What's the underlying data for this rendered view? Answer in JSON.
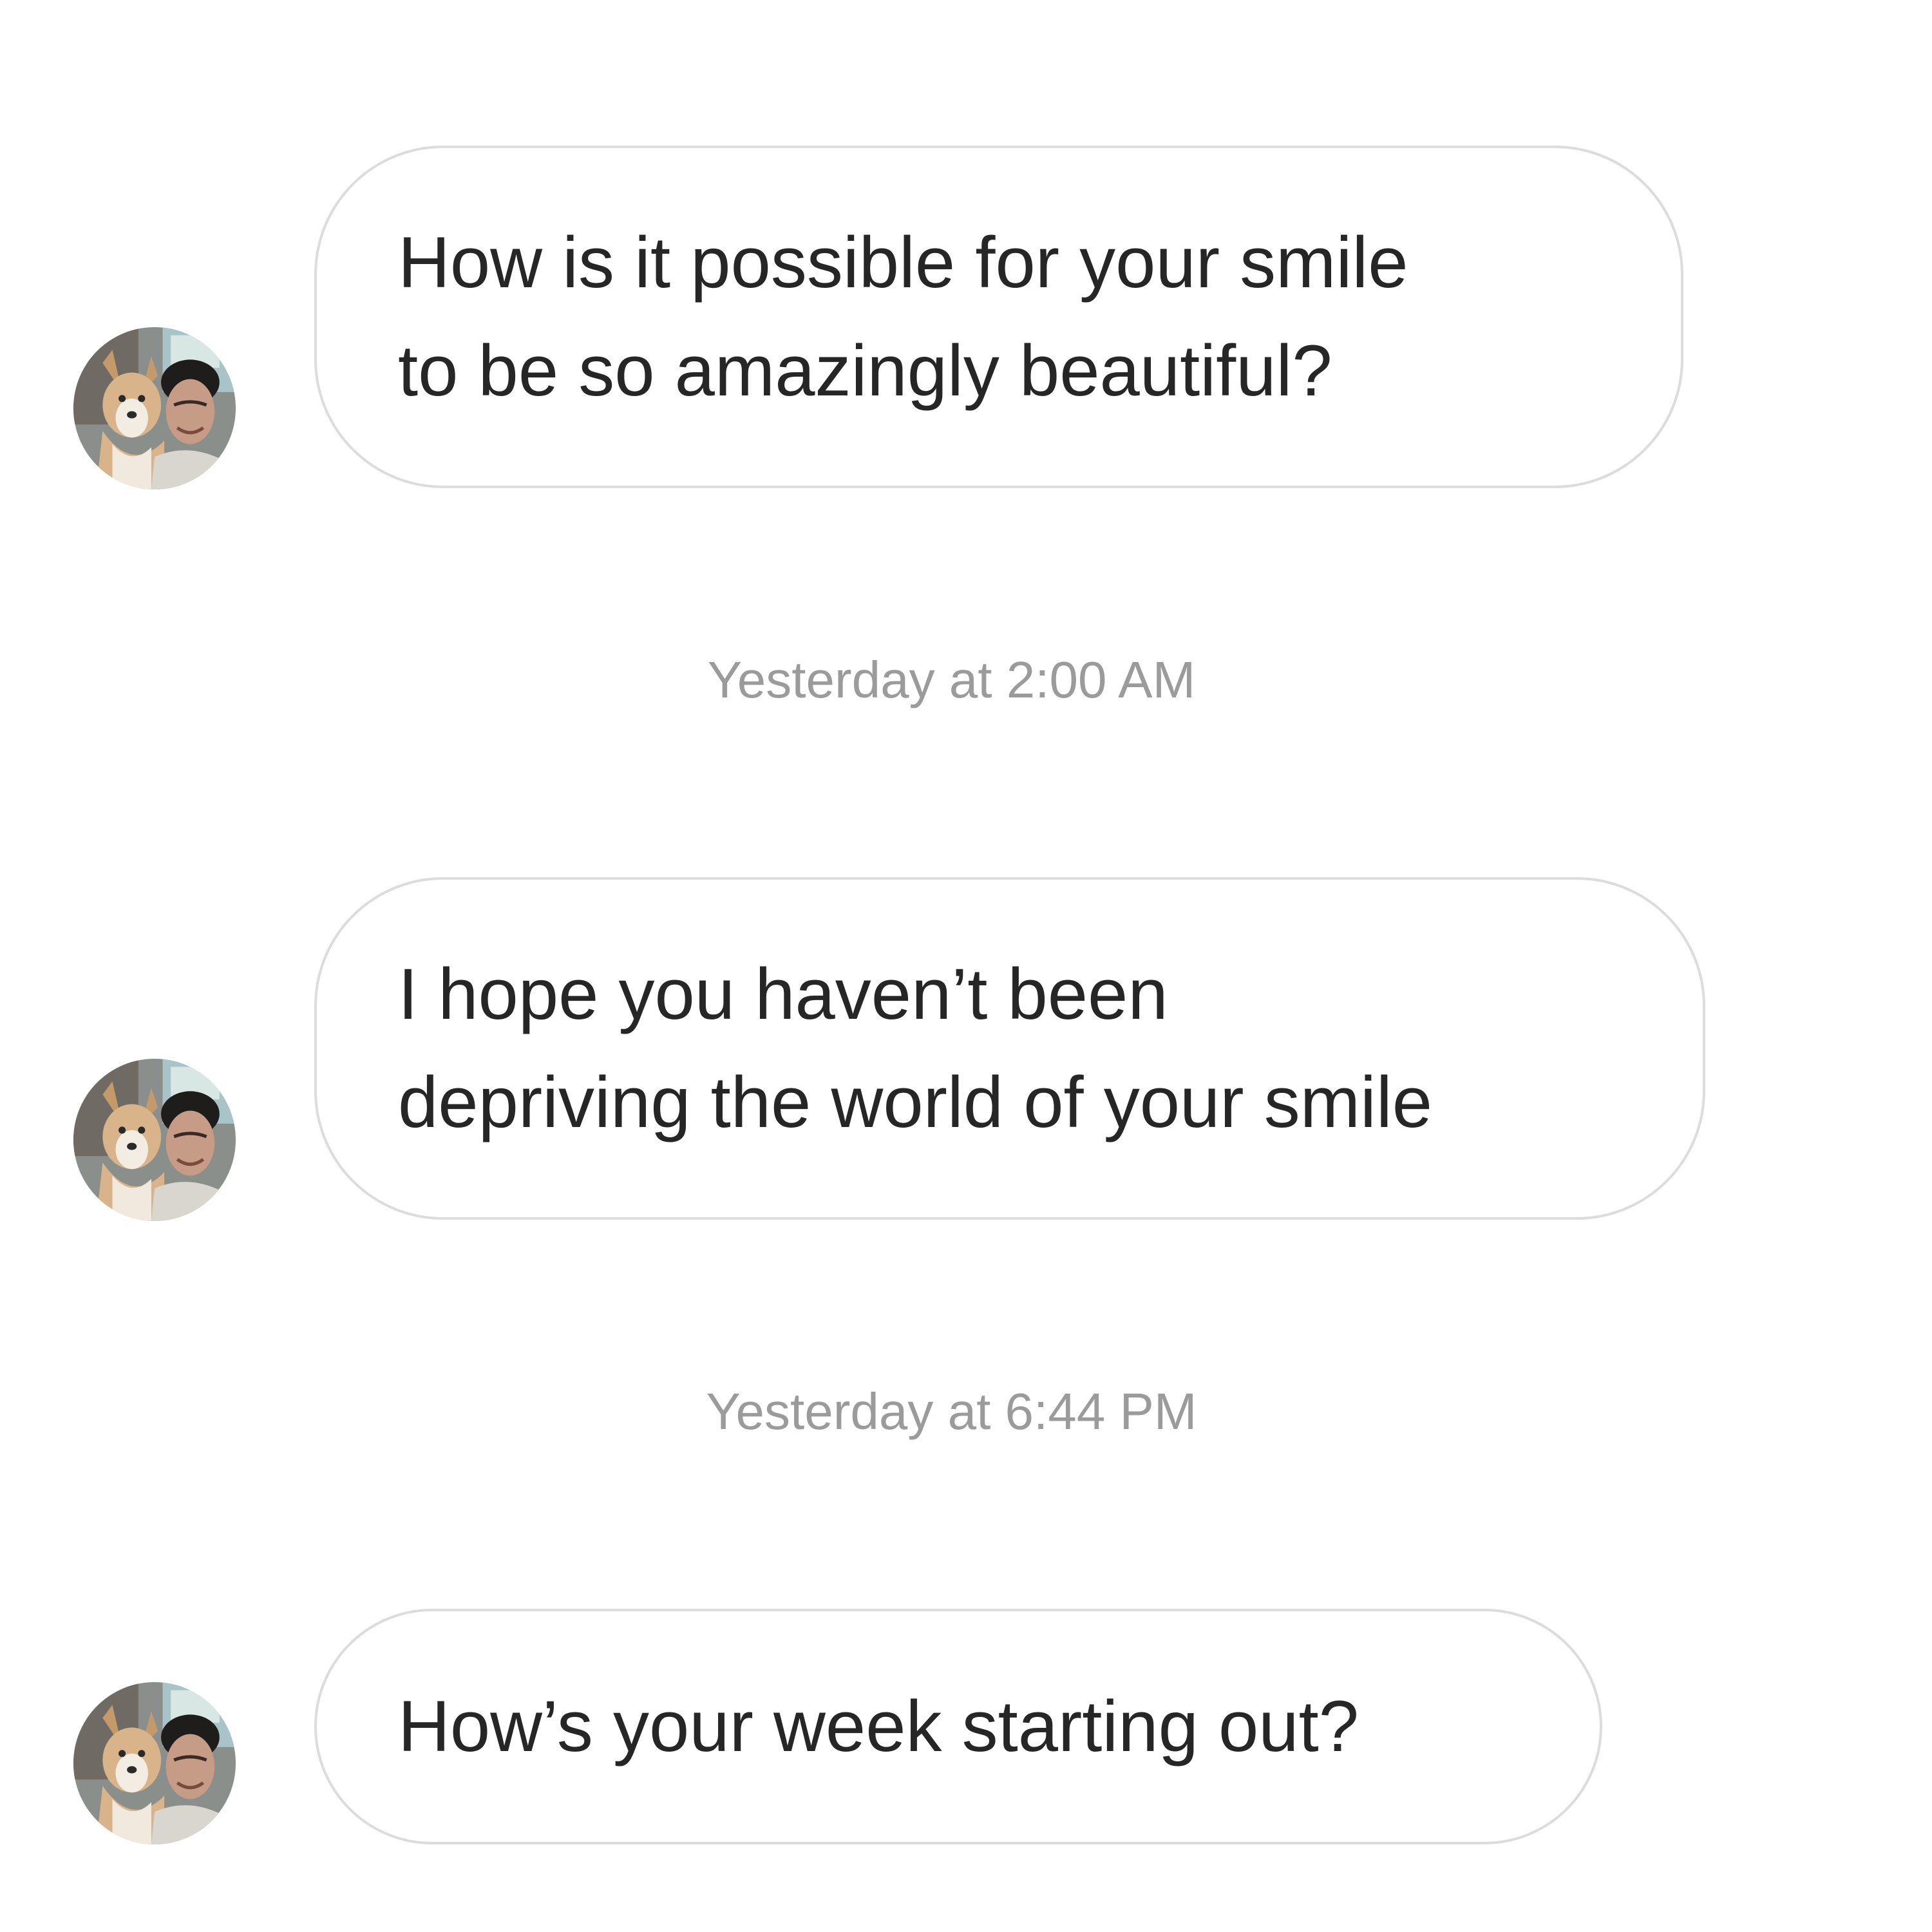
{
  "messages": [
    {
      "lines": [
        "How is it possible for your smile",
        "to be so amazingly beautiful?"
      ]
    },
    {
      "lines": [
        "I hope you haven’t been",
        "depriving the world of your smile"
      ]
    },
    {
      "lines": [
        "How’s your week starting out?"
      ]
    }
  ],
  "timestamps": [
    "Yesterday at 2:00 AM",
    "Yesterday at 6:44 PM"
  ],
  "avatar": {
    "icon": "profile-photo-man-with-dog"
  },
  "colors": {
    "background": "#ffffff",
    "bubble_border": "#dcdcdc",
    "message_text": "#262626",
    "timestamp_text": "#9b9b9b"
  }
}
